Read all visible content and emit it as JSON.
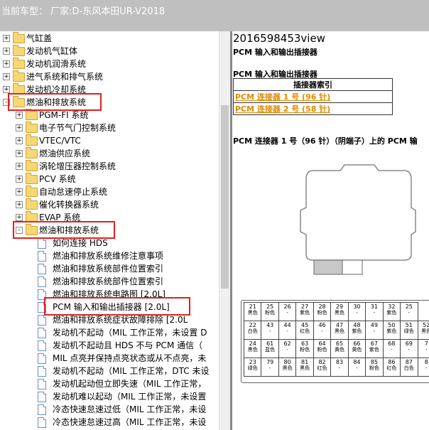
{
  "header": {
    "vehicle_label": "当前车型：  厂家:D-东风本田UR-V2018"
  },
  "tree": {
    "rows": [
      {
        "label": "气缸盖",
        "type": "folder",
        "level": 0,
        "expander": "+"
      },
      {
        "label": "发动机气缸体",
        "type": "folder",
        "level": 0,
        "expander": "+"
      },
      {
        "label": "发动机润滑系统",
        "type": "folder",
        "level": 0,
        "expander": "+"
      },
      {
        "label": "进气系统和排气系统",
        "type": "folder",
        "level": 0,
        "expander": "+"
      },
      {
        "label": "发动机冷却系统",
        "type": "folder",
        "level": 0,
        "expander": "+"
      },
      {
        "label": "燃油和排放系统",
        "type": "folder",
        "level": 0,
        "expander": "-"
      },
      {
        "label": "PGM-FI 系统",
        "type": "folder",
        "level": 1,
        "expander": "+"
      },
      {
        "label": "电子节气门控制系统",
        "type": "folder",
        "level": 1,
        "expander": "+"
      },
      {
        "label": "VTEC/VTC",
        "type": "folder",
        "level": 1,
        "expander": "+"
      },
      {
        "label": "燃油供应系统",
        "type": "folder",
        "level": 1,
        "expander": "+"
      },
      {
        "label": "涡轮增压器控制系统",
        "type": "folder",
        "level": 1,
        "expander": "+"
      },
      {
        "label": "PCV 系统",
        "type": "folder",
        "level": 1,
        "expander": "+"
      },
      {
        "label": "自动怠速停止系统",
        "type": "folder",
        "level": 1,
        "expander": "+"
      },
      {
        "label": "催化转换器系统",
        "type": "folder",
        "level": 1,
        "expander": "+"
      },
      {
        "label": "EVAP 系统",
        "type": "folder",
        "level": 1,
        "expander": "+"
      },
      {
        "label": "燃油和排放系统",
        "type": "folder",
        "level": 1,
        "expander": "-"
      },
      {
        "label": "如何连接 HDS",
        "type": "doc",
        "level": 2
      },
      {
        "label": "燃油和排放系统维修注意事项",
        "type": "doc",
        "level": 2
      },
      {
        "label": "燃油和排放系统部件位置索引",
        "type": "doc",
        "level": 2
      },
      {
        "label": "燃油和排放系统部件位置索引",
        "type": "doc",
        "level": 2
      },
      {
        "label": "燃油和排放系统电路图 [2.0L]",
        "type": "doc",
        "level": 2
      },
      {
        "label": "PCM 输入和输出插接器 [2.0L]",
        "type": "doc",
        "level": 2
      },
      {
        "label": "燃油和排放系统症状故障排除 [2.0L",
        "type": "doc",
        "level": 2
      },
      {
        "label": "发动机不起动（MIL 工作正常，未设置 D",
        "type": "doc",
        "level": 2
      },
      {
        "label": "发动机不起动且 HDS 不与 PCM 通信（",
        "type": "doc",
        "level": 2
      },
      {
        "label": "MIL 点亮并保持点亮状态或从不点亮，未",
        "type": "doc",
        "level": 2
      },
      {
        "label": "发动机不起动（MIL 工作正常，DTC 未设",
        "type": "doc",
        "level": 2
      },
      {
        "label": "发动机起动但立即失速（MIL 工作正常，",
        "type": "doc",
        "level": 2
      },
      {
        "label": "发动机难以起动（MIL 工作正常，未设置",
        "type": "doc",
        "level": 2
      },
      {
        "label": "冷态快速怠速过低（MIL 工作正常，未设",
        "type": "doc",
        "level": 2
      },
      {
        "label": "冷态快速怠速过高（MIL 工作正常，未设",
        "type": "doc",
        "level": 2
      }
    ]
  },
  "content": {
    "doc_id": "2016598453view",
    "heading1": "PCM 输入和输出插接器",
    "heading2": "PCM 输入和输出插接器",
    "index_header": "插接器索引",
    "link1": "PCM 连接器 1 号 (96 针)",
    "link2": "PCM 连接器 2 号 (58 针)",
    "section_title": "PCM 连接器 1 号（96 针）（阴端子）上的 PCM 输",
    "pins": [
      [
        {
          "n": "21",
          "c": "黑色"
        },
        {
          "n": "25",
          "c": "粉色"
        },
        {
          "n": "26",
          "c": "-"
        },
        {
          "n": "27",
          "c": "紫色"
        },
        {
          "n": "28",
          "c": "粉色"
        },
        {
          "n": "29",
          "c": "黑色"
        },
        {
          "n": "30",
          "c": "-"
        },
        {
          "n": "31",
          "c": "-"
        },
        {
          "n": "32",
          "c": "紫色"
        },
        {
          "n": "25",
          "c": "-"
        }
      ],
      [
        {
          "n": "22",
          "c": "白色"
        },
        {
          "n": "43",
          "c": "-"
        },
        {
          "n": "44",
          "c": "-"
        },
        {
          "n": "45",
          "c": "红色"
        },
        {
          "n": "46",
          "c": "-"
        },
        {
          "n": "47",
          "c": "黑色"
        },
        {
          "n": "48",
          "c": "紫色"
        },
        {
          "n": "49",
          "c": "-"
        },
        {
          "n": "50",
          "c": "紫色"
        },
        {
          "n": "51",
          "c": "绿色"
        },
        {
          "n": "52",
          "c": "黑色"
        }
      ],
      [
        {
          "n": "24",
          "c": "黑色"
        },
        {
          "n": "61",
          "c": "蓝色"
        },
        {
          "n": "62",
          "c": "-"
        },
        {
          "n": "63",
          "c": "粉色"
        },
        {
          "n": "64",
          "c": "粉色"
        },
        {
          "n": "65",
          "c": "黄色"
        },
        {
          "n": "66",
          "c": "黄色"
        },
        {
          "n": "67",
          "c": "紫色"
        },
        {
          "n": "68",
          "c": "-"
        },
        {
          "n": "69",
          "c": "-"
        },
        {
          "n": "7",
          "c": "-"
        }
      ],
      [
        {
          "n": "23",
          "c": "绿色"
        },
        {
          "n": "79",
          "c": "-"
        },
        {
          "n": "80",
          "c": "黑色"
        },
        {
          "n": "81",
          "c": "黑色"
        },
        {
          "n": "82",
          "c": "红色"
        },
        {
          "n": "83",
          "c": "-"
        },
        {
          "n": "84",
          "c": "-"
        },
        {
          "n": "85",
          "c": "粉色"
        },
        {
          "n": "86",
          "c": "红色"
        },
        {
          "n": "87",
          "c": "白色"
        },
        {
          "n": "8",
          "c": "-"
        }
      ]
    ]
  }
}
